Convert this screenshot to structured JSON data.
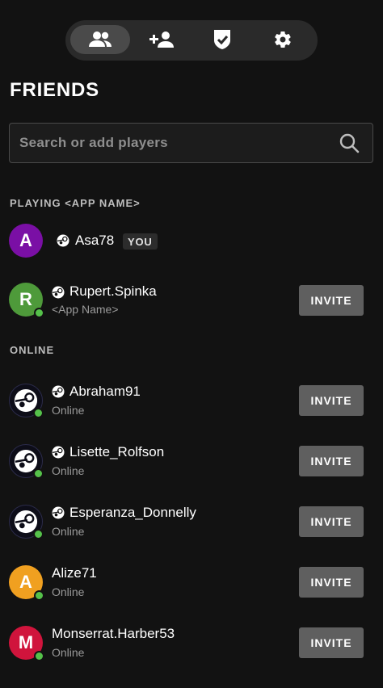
{
  "tabs": [
    {
      "name": "friends",
      "icon": "friends-icon",
      "active": true
    },
    {
      "name": "add-friend",
      "icon": "add-friend-icon",
      "active": false
    },
    {
      "name": "shield",
      "icon": "shield-check-icon",
      "active": false
    },
    {
      "name": "settings",
      "icon": "gear-icon",
      "active": false
    }
  ],
  "title": "FRIENDS",
  "search": {
    "placeholder": "Search or add players",
    "value": ""
  },
  "sections": {
    "playing": "PLAYING <APP NAME>",
    "online": "ONLINE"
  },
  "you_badge": "YOU",
  "invite_label": "INVITE",
  "players": {
    "self": {
      "initial": "A",
      "name": "Asa78",
      "avatar_color": "#7a0fa5",
      "platform": "steam-icon"
    },
    "rupert": {
      "initial": "R",
      "name": "Rupert.Spinka",
      "status": "<App Name>",
      "avatar_color": "#4e9a3a",
      "platform": "steam-icon"
    },
    "abraham": {
      "name": "Abraham91",
      "status": "Online",
      "platform": "steam-icon"
    },
    "lisette": {
      "name": "Lisette_Rolfson",
      "status": "Online",
      "platform": "steam-icon"
    },
    "esperanza": {
      "name": "Esperanza_Donnelly",
      "status": "Online",
      "platform": "steam-icon"
    },
    "alize": {
      "initial": "A",
      "name": "Alize71",
      "status": "Online",
      "avatar_color": "#f0a020"
    },
    "monserrat": {
      "initial": "M",
      "name": "Monserrat.Harber53",
      "status": "Online",
      "avatar_color": "#d0143c"
    }
  },
  "colors": {
    "background": "#121212",
    "online_dot": "#55c14a",
    "invite_button": "#5f5f5f"
  }
}
